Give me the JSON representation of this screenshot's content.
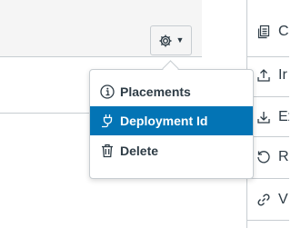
{
  "menu": {
    "items": [
      {
        "label": "Placements",
        "icon": "info-icon"
      },
      {
        "label": "Deployment Id",
        "icon": "plug-icon",
        "active": true
      },
      {
        "label": "Delete",
        "icon": "trash-icon"
      }
    ]
  },
  "side_panel": {
    "items": [
      {
        "label": "C",
        "icon": "copy-icon"
      },
      {
        "label": "Ir",
        "icon": "upload-icon"
      },
      {
        "label": "Ex",
        "icon": "download-icon"
      },
      {
        "label": "R",
        "icon": "refresh-icon"
      },
      {
        "label": "V",
        "icon": "link-icon"
      }
    ]
  },
  "colors": {
    "accent": "#0374b5",
    "border": "#c7cdd1",
    "text": "#2d3b45"
  }
}
